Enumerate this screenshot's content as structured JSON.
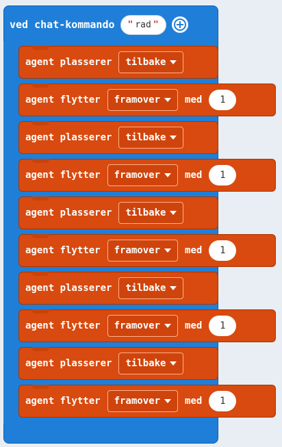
{
  "event": {
    "label": "ved chat-kommando",
    "command": "rad"
  },
  "blocks": [
    {
      "type": "place",
      "label": "agent plasserer",
      "dropdown": "tilbake"
    },
    {
      "type": "move",
      "label": "agent flytter",
      "dropdown": "framover",
      "med_label": "med",
      "value": "1"
    },
    {
      "type": "place",
      "label": "agent plasserer",
      "dropdown": "tilbake"
    },
    {
      "type": "move",
      "label": "agent flytter",
      "dropdown": "framover",
      "med_label": "med",
      "value": "1"
    },
    {
      "type": "place",
      "label": "agent plasserer",
      "dropdown": "tilbake"
    },
    {
      "type": "move",
      "label": "agent flytter",
      "dropdown": "framover",
      "med_label": "med",
      "value": "1"
    },
    {
      "type": "place",
      "label": "agent plasserer",
      "dropdown": "tilbake"
    },
    {
      "type": "move",
      "label": "agent flytter",
      "dropdown": "framover",
      "med_label": "med",
      "value": "1"
    },
    {
      "type": "place",
      "label": "agent plasserer",
      "dropdown": "tilbake"
    },
    {
      "type": "move",
      "label": "agent flytter",
      "dropdown": "framover",
      "med_label": "med",
      "value": "1"
    }
  ],
  "icons": {
    "add": "plus-circle-icon",
    "caret": "caret-down-icon"
  },
  "colors": {
    "event": "#1f7fd8",
    "agent": "#d84a0f"
  }
}
